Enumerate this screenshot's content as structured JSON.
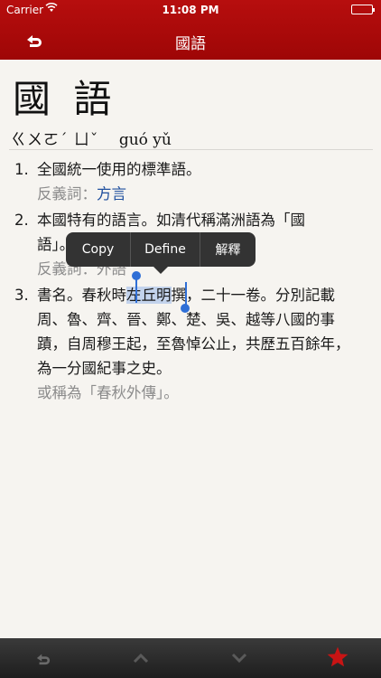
{
  "status_bar": {
    "carrier": "Carrier",
    "time": "11:08 PM"
  },
  "nav": {
    "title": "國語",
    "back_icon": "undo-arrow-icon"
  },
  "entry": {
    "headword": "國 語",
    "zhuyin": "ㄍㄨㄛˊ ㄩˇ",
    "pinyin": "guó yǔ",
    "definitions": [
      {
        "num": "1.",
        "text": "全國統一使用的標準語。",
        "sub_label": "反義詞：",
        "sub_link": "方言"
      },
      {
        "num": "2.",
        "text_a": "本國特有的語言。如清代稱滿洲語為「國",
        "text_b": "語」。",
        "sub_label": "反義詞：",
        "sub_link": "外語"
      },
      {
        "num": "3.",
        "text_pre": "書名。春秋時",
        "text_hl": "左丘明",
        "text_post": "撰，二十一卷。分別記載周、魯、齊、晉、鄭、楚、吳、越等八國的事蹟，自周穆王起，至魯悼公止，共歷五百餘年，為一分國紀事之史。",
        "sub": "或稱為「春秋外傳」。"
      }
    ]
  },
  "callout_menu": {
    "copy": "Copy",
    "define": "Define",
    "explain": "解釋"
  },
  "toolbar": {
    "back_icon": "undo-arrow-icon",
    "up_icon": "chevron-up-icon",
    "down_icon": "chevron-down-icon",
    "favorite_icon": "star-icon",
    "accent": "#c81414"
  }
}
